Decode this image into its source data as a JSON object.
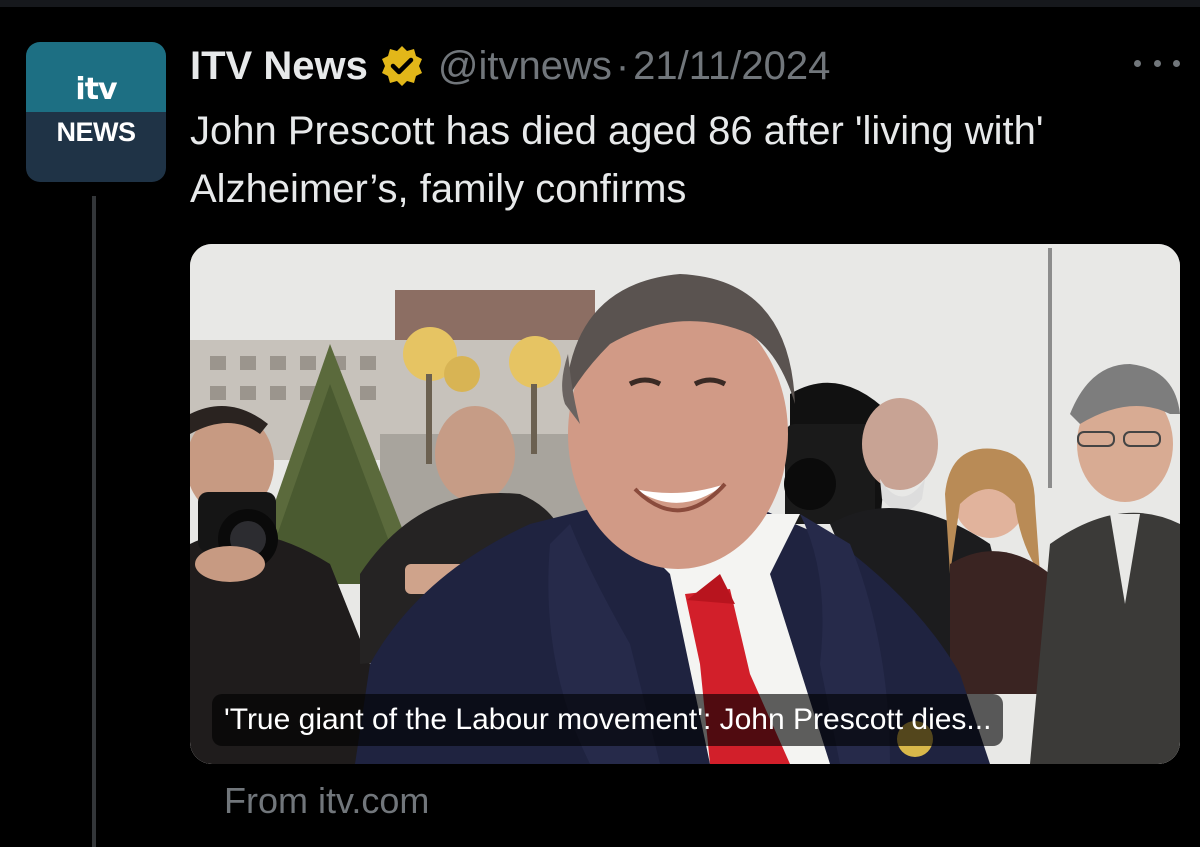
{
  "tweet": {
    "display_name": "ITV News",
    "handle": "@itvnews",
    "separator": "·",
    "date": "21/11/2024",
    "verified": true,
    "text": "John Prescott has died aged 86 after 'living with' Alzheimer’s, family confirms"
  },
  "avatar": {
    "logo_text": "itv",
    "logo_subtext": "NEWS"
  },
  "link_card": {
    "caption": "'True giant of the Labour movement': John Prescott dies...",
    "source": "From itv.com"
  },
  "icons": {
    "verified": "verified-badge-icon",
    "more": "more-horizontal-icon"
  },
  "colors": {
    "background": "#000000",
    "text_primary": "#e7e9ea",
    "text_secondary": "#71767b",
    "verified_gold": "#e2b719",
    "avatar_top": "#1d6f83",
    "avatar_bottom": "#1f3346"
  }
}
